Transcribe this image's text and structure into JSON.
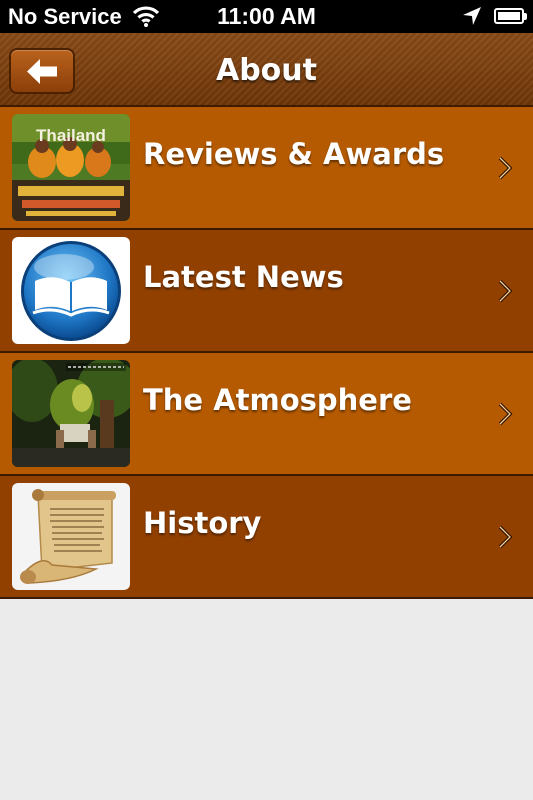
{
  "status_bar": {
    "carrier": "No Service",
    "time": "11:00 AM"
  },
  "navbar": {
    "title": "About",
    "back_icon": "back-arrow-icon"
  },
  "rows": [
    {
      "label": "Reviews & Awards",
      "thumb": "thailand-guidebook-image",
      "thumb_text": "Thailand"
    },
    {
      "label": "Latest News",
      "thumb": "book-icon"
    },
    {
      "label": "The Atmosphere",
      "thumb": "restaurant-garden-image"
    },
    {
      "label": "History",
      "thumb": "scroll-image"
    }
  ],
  "colors": {
    "row_light": "#b55a00",
    "row_dark": "#914000",
    "navbar": "#7a3f0f",
    "background": "#ebebeb"
  }
}
